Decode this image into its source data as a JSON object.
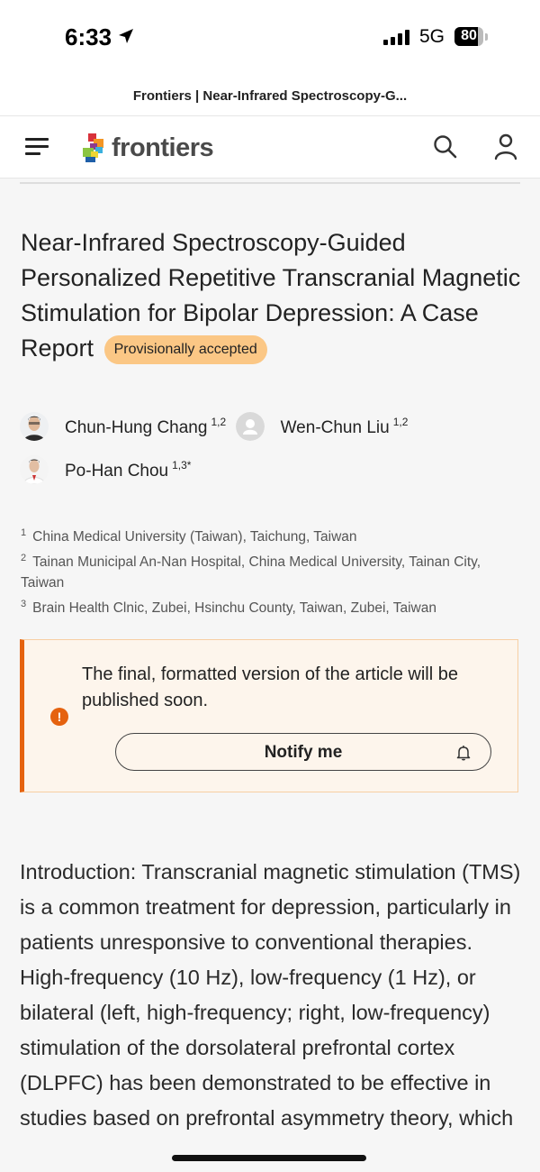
{
  "status_bar": {
    "time": "6:33",
    "location_icon": "location-arrow-icon",
    "signal_icon": "cellular-signal-icon",
    "network": "5G",
    "battery": "80",
    "battery_level_percent": 80
  },
  "browser": {
    "page_title": "Frontiers | Near-Infrared Spectroscopy-G..."
  },
  "navbar": {
    "menu_icon": "hamburger-menu-icon",
    "brand": "frontiers",
    "search_icon": "search-icon",
    "account_icon": "user-icon"
  },
  "article": {
    "title": "Near-Infrared Spectroscopy-Guided Personalized Repetitive Transcranial Magnetic Stimulation for Bipolar Depression: A Case Report",
    "status_badge": "Provisionally accepted",
    "authors": [
      {
        "name": "Chun-Hung Chang",
        "affil": "1,2",
        "avatar": "photo"
      },
      {
        "name": "Wen-Chun Liu",
        "affil": "1,2",
        "avatar": "placeholder"
      },
      {
        "name": "Po-Han Chou",
        "affil": "1,3*",
        "avatar": "photo"
      }
    ],
    "affiliations": [
      {
        "num": "1",
        "text": "China Medical University (Taiwan), Taichung, Taiwan"
      },
      {
        "num": "2",
        "text": "Tainan Municipal An-Nan Hospital, China Medical University, Tainan City, Taiwan"
      },
      {
        "num": "3",
        "text": "Brain Health Clnic, Zubei, Hsinchu County, Taiwan, Zubei, Taiwan"
      }
    ],
    "notice": {
      "icon": "alert-icon",
      "message": "The final, formatted version of the article will be published soon.",
      "button_label": "Notify me",
      "button_icon": "bell-icon"
    },
    "abstract": "Introduction: Transcranial magnetic stimulation (TMS) is a common treatment for depression, particularly in patients unresponsive to conventional therapies. High-frequency (10 Hz), low-frequency (1 Hz), or bilateral (left, high-frequency; right, low-frequency) stimulation of the dorsolateral prefrontal cortex (DLPFC) has been demonstrated to be effective in studies based on prefrontal asymmetry theory, which"
  },
  "colors": {
    "accent_orange": "#e5620f",
    "badge_bg": "#fbc785",
    "notice_bg": "#fdf5ec"
  }
}
